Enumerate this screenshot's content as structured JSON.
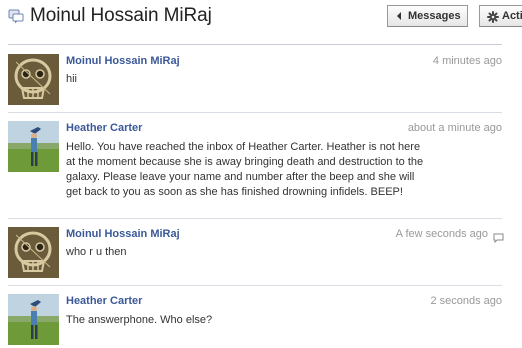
{
  "header": {
    "title": "Moinul Hossain MiRaj",
    "messages_button": "Messages",
    "actions_button": "Actions"
  },
  "messages": [
    {
      "author": "Moinul Hossain MiRaj",
      "time": "4 minutes ago",
      "text": "hii",
      "avatar": "skull-drawing-avatar"
    },
    {
      "author": "Heather Carter",
      "time": "about a minute ago",
      "text": "Hello. You have reached the inbox of Heather Carter. Heather is not here at the moment because she is away bringing death and destruction to the galaxy. Please leave your name and number after the beep and she will get back to you as soon as she has finished drowning infidels. BEEP!",
      "avatar": "person-in-field-avatar"
    },
    {
      "author": "Moinul Hossain MiRaj",
      "time": "A few seconds ago",
      "text": "who r u then",
      "avatar": "skull-drawing-avatar"
    },
    {
      "author": "Heather Carter",
      "time": "2 seconds ago",
      "text": "The answerphone. Who else?",
      "avatar": "person-in-field-avatar"
    }
  ]
}
